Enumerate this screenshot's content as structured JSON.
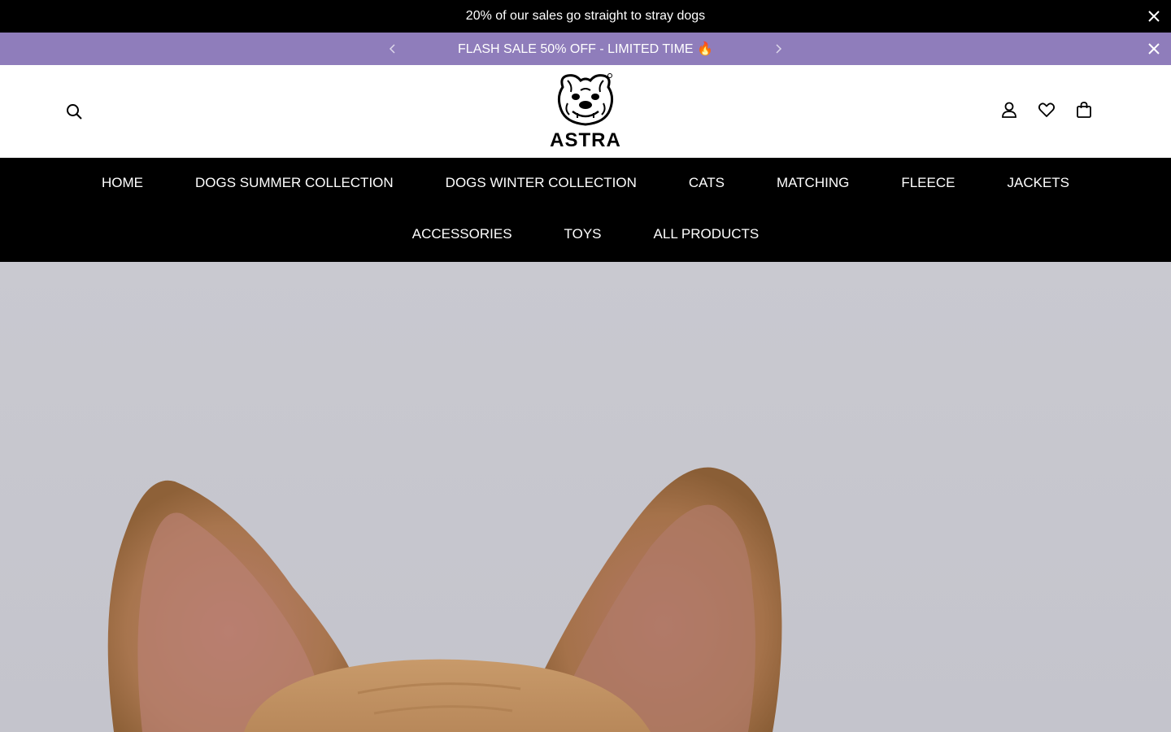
{
  "announcement": {
    "text": "20% of our sales go straight to stray dogs"
  },
  "promo": {
    "text": "FLASH SALE 50% OFF - LIMITED TIME 🔥"
  },
  "logo": {
    "text": "ASTRA"
  },
  "nav": {
    "row1": [
      "HOME",
      "DOGS SUMMER COLLECTION",
      "DOGS WINTER COLLECTION",
      "CATS",
      "MATCHING",
      "FLEECE",
      "JACKETS"
    ],
    "row2": [
      "ACCESSORIES",
      "TOYS",
      "ALL PRODUCTS"
    ]
  },
  "icons": {
    "search": "search-icon",
    "account": "account-icon",
    "wishlist": "heart-icon",
    "cart": "shopping-bag-icon"
  },
  "colors": {
    "announcement_bg": "#000000",
    "promo_bg": "#8f7dbb",
    "nav_bg": "#000000",
    "hero_bg": "#c8c8cf"
  }
}
